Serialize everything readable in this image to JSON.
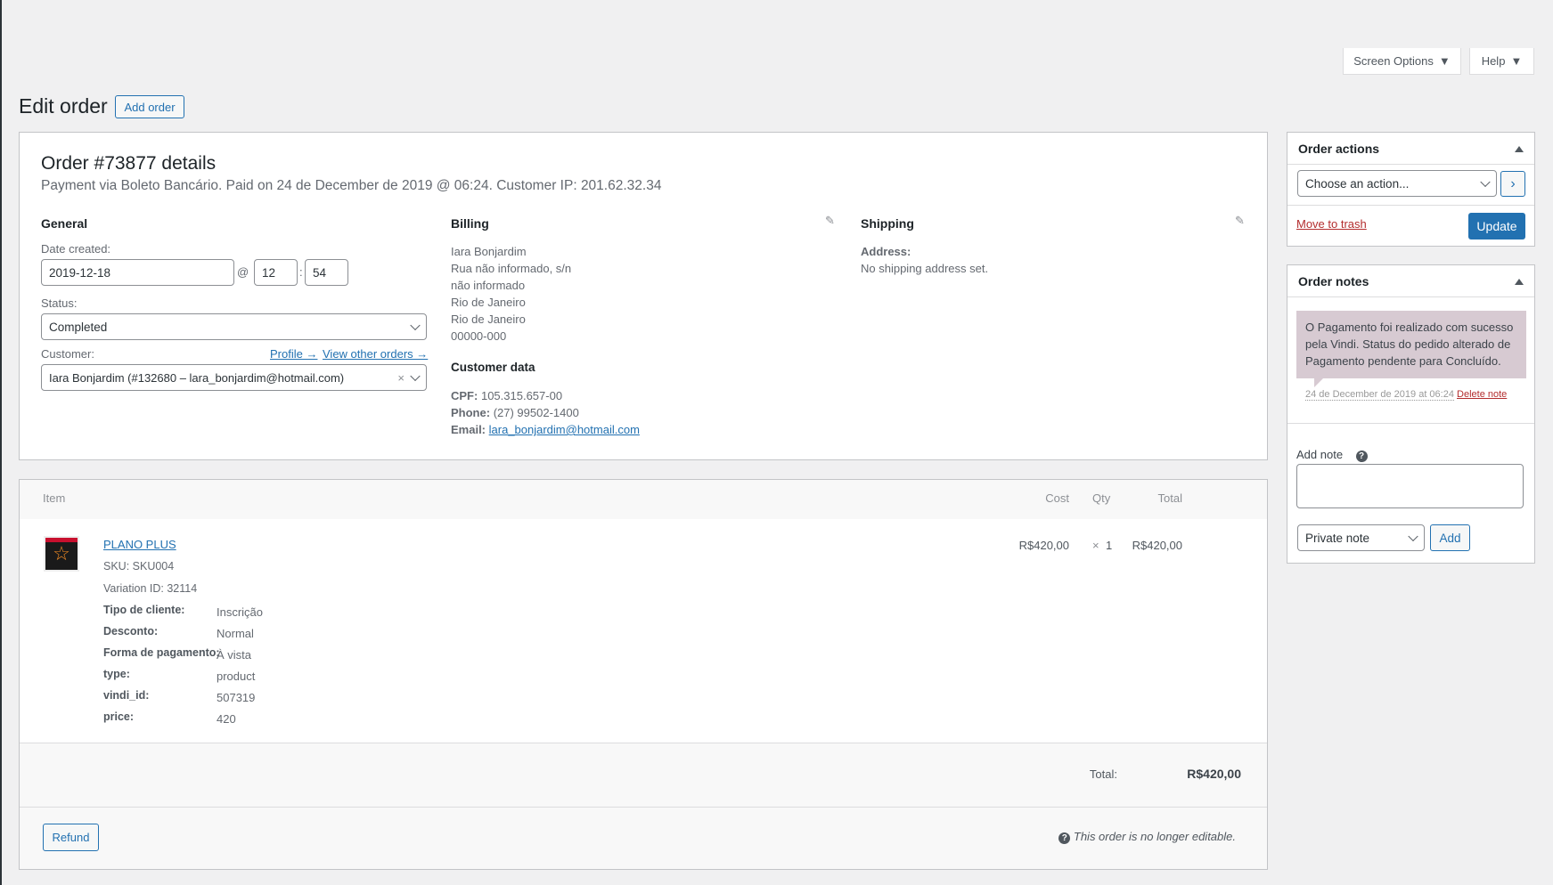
{
  "header": {
    "screen_options": "Screen Options",
    "help": "Help",
    "title": "Edit order",
    "add_order": "Add order"
  },
  "order": {
    "title": "Order #73877 details",
    "subtitle": "Payment via Boleto Bancário. Paid on 24 de December de 2019 @ 06:24. Customer IP: 201.62.32.34"
  },
  "general": {
    "heading": "General",
    "date_label": "Date created:",
    "date": "2019-12-18",
    "at": "@",
    "hour": "12",
    "colon": ":",
    "minute": "54",
    "status_label": "Status:",
    "status": "Completed",
    "customer_label": "Customer:",
    "profile_link": "Profile →",
    "other_orders_link": "View other orders →",
    "customer": "Iara Bonjardim (#132680 – lara_bonjardim@hotmail.com)",
    "clear": "×"
  },
  "billing": {
    "heading": "Billing",
    "lines": [
      "Iara Bonjardim",
      "Rua não informado, s/n",
      "não informado",
      "Rio de Janeiro",
      "Rio de Janeiro",
      "00000-000"
    ],
    "customer_data_heading": "Customer data",
    "cpf_label": "CPF:",
    "cpf": "105.315.657-00",
    "phone_label": "Phone:",
    "phone": "(27) 99502-1400",
    "email_label": "Email:",
    "email": "lara_bonjardim@hotmail.com"
  },
  "shipping": {
    "heading": "Shipping",
    "address_label": "Address:",
    "address": "No shipping address set."
  },
  "items": {
    "headers": {
      "item": "Item",
      "cost": "Cost",
      "qty": "Qty",
      "total": "Total"
    },
    "row": {
      "name": "PLANO PLUS",
      "sku": "SKU: SKU004",
      "variation_label": "Variation ID:",
      "variation": "32114",
      "cost": "R$420,00",
      "qty_x": "×",
      "qty": "1",
      "total": "R$420,00",
      "meta": [
        {
          "k": "Tipo de cliente:",
          "v": "Inscrição"
        },
        {
          "k": "Desconto:",
          "v": "Normal"
        },
        {
          "k": "Forma de pagamento:",
          "v": "À vista"
        },
        {
          "k": "type:",
          "v": "product"
        },
        {
          "k": "vindi_id:",
          "v": "507319"
        },
        {
          "k": "price:",
          "v": "420"
        }
      ]
    },
    "total_label": "Total:",
    "total_value": "R$420,00",
    "refund": "Refund",
    "not_editable": "This order is no longer editable."
  },
  "actions": {
    "heading": "Order actions",
    "select": "Choose an action...",
    "go": "›",
    "trash": "Move to trash",
    "update": "Update"
  },
  "notes": {
    "heading": "Order notes",
    "note": "O Pagamento foi realizado com sucesso pela Vindi. Status do pedido alterado de Pagamento pendente para Concluído.",
    "date": "24 de December de 2019 at 06:24",
    "delete": "Delete note",
    "add_label": "Add note",
    "note_type": "Private note",
    "add": "Add"
  },
  "colors": {
    "primary": "#2271b1",
    "danger": "#b32d2e",
    "note_bg": "#d7cad2"
  }
}
